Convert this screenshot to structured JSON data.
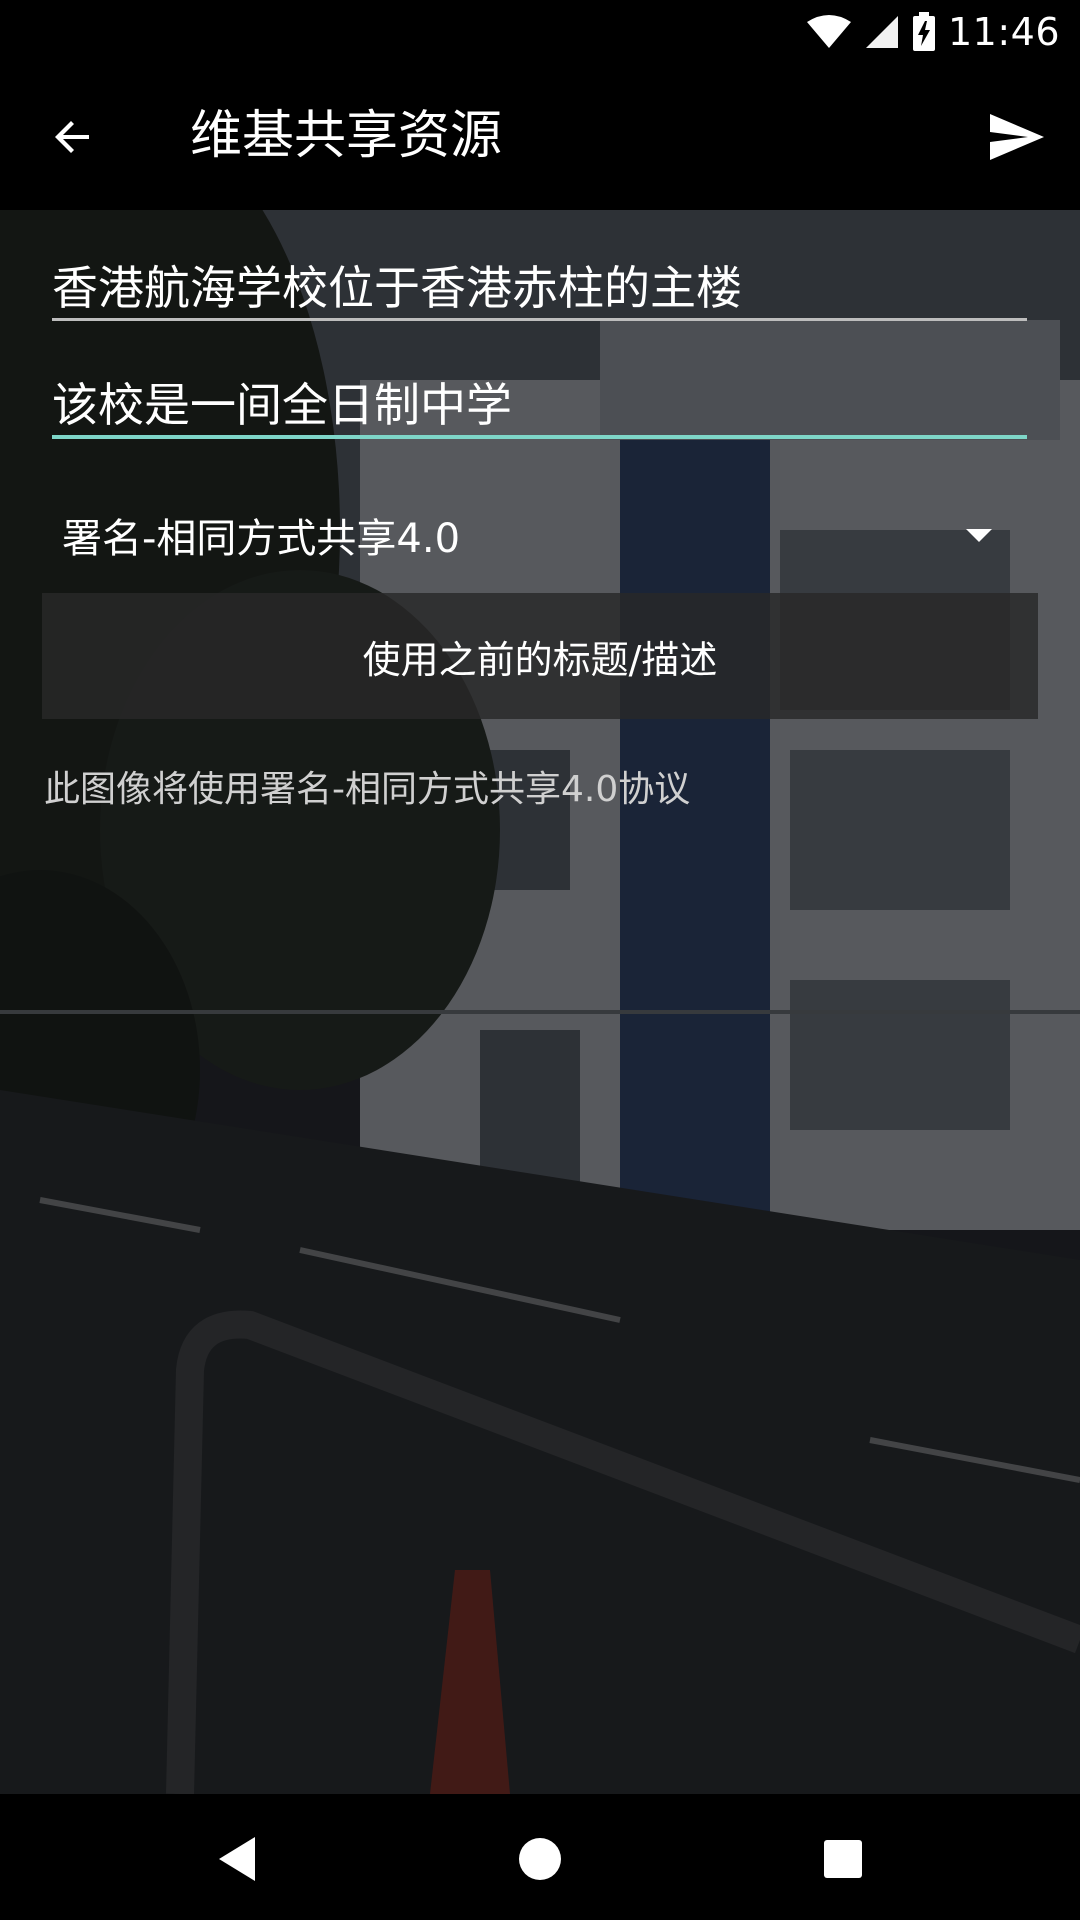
{
  "status_bar": {
    "time": "11:46",
    "icons": [
      "wifi-icon",
      "signal-icon",
      "battery-charging-icon"
    ]
  },
  "app_bar": {
    "title": "维基共享资源",
    "back_icon": "arrow-back-icon",
    "send_icon": "send-icon"
  },
  "form": {
    "title_value": "香港航海学校位于香港赤柱的主楼",
    "description_value": "该校是一间全日制中学",
    "license_selected": "署名-相同方式共享4.0",
    "previous_button_label": "使用之前的标题/描述",
    "license_note": "此图像将使用署名-相同方式共享4.0协议"
  },
  "nav_bar": {
    "icons": [
      "back-triangle-icon",
      "home-circle-icon",
      "recents-square-icon"
    ]
  },
  "colors": {
    "accent_underline": "#7ed6c8",
    "inactive_underline": "#bdbdbd",
    "button_bg": "#282828"
  }
}
